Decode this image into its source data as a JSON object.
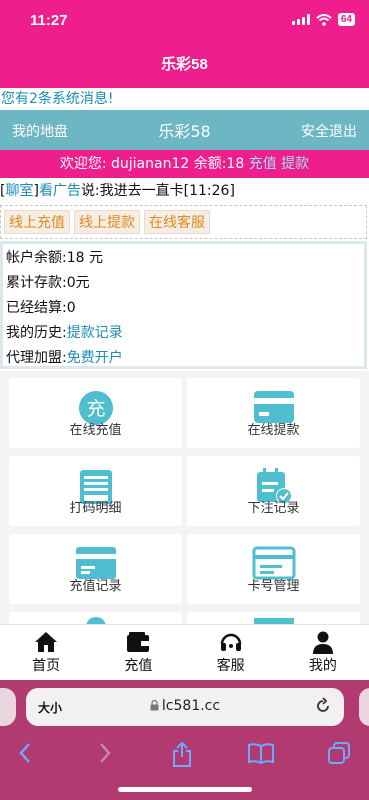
{
  "status": {
    "time": "11:27",
    "battery": "64"
  },
  "header": {
    "title": "乐彩58"
  },
  "system_message": "您有2条系统消息!",
  "nav": {
    "left": "我的地盘",
    "center": "乐彩58",
    "right": "安全退出"
  },
  "welcome": {
    "prefix": "欢迎您: dujianan12 余额:18",
    "recharge": "充值",
    "withdraw": "提款"
  },
  "chat": {
    "open": "[",
    "room": "聊室",
    "close": "]",
    "ad": "看广告",
    "message": "说:我进去一直卡[11:26]"
  },
  "quick_actions": [
    "线上充值",
    "线上提款",
    "在线客服"
  ],
  "account": {
    "balance": "帐户余额:18 元",
    "deposit": "累计存款:0元",
    "settled": "已经结算:0",
    "history_label": "我的历史:",
    "history_link": "提款记录",
    "agent_label": "代理加盟:",
    "agent_link": "免费开户"
  },
  "tiles": [
    {
      "label": "在线充值",
      "icon": "recharge-icon",
      "glyph": "充"
    },
    {
      "label": "在线提款",
      "icon": "card-icon"
    },
    {
      "label": "打码明细",
      "icon": "printer-icon"
    },
    {
      "label": "下注记录",
      "icon": "calendar-check-icon"
    },
    {
      "label": "充值记录",
      "icon": "card-record-icon"
    },
    {
      "label": "卡号管理",
      "icon": "card-manage-icon"
    }
  ],
  "tabbar": [
    {
      "label": "首页",
      "icon": "home-icon"
    },
    {
      "label": "充值",
      "icon": "wallet-icon"
    },
    {
      "label": "客服",
      "icon": "headset-icon"
    },
    {
      "label": "我的",
      "icon": "user-icon"
    }
  ],
  "browser": {
    "aa": "大小",
    "url": "lc581.cc"
  },
  "colors": {
    "brand": "#ee1f8c",
    "teal": "#6db7c4",
    "link": "#1c8cb3",
    "accent_orange": "#e08a1c",
    "icon_teal": "#4fbfcf"
  }
}
